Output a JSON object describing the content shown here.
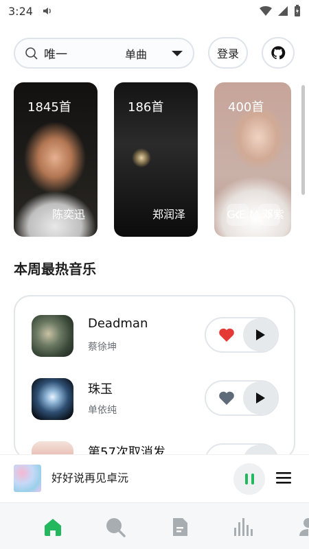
{
  "status_bar": {
    "time": "3:24"
  },
  "search": {
    "query": "唯一",
    "type": "单曲"
  },
  "header": {
    "login_label": "登录"
  },
  "artists": [
    {
      "count": "1845首",
      "name": "陈奕迅"
    },
    {
      "count": "186首",
      "name": "郑润泽"
    },
    {
      "count": "400首",
      "name": "G.E.M.邓紫"
    }
  ],
  "section": {
    "title": "本周最热音乐"
  },
  "tracks": [
    {
      "title": "Deadman",
      "artist": "蔡徐坤",
      "liked": true
    },
    {
      "title": "珠玉",
      "artist": "单依纯",
      "liked": false
    },
    {
      "title": "第57次取消发",
      "artist": "",
      "liked": false
    }
  ],
  "mini_player": {
    "title": "好好说再见卓沅"
  },
  "colors": {
    "accent": "#23b85d",
    "like": "#e53935",
    "muted": "#5f6b78"
  },
  "icons": {
    "nav": [
      "home-icon",
      "search-icon",
      "document-icon",
      "chart-icon",
      "user-icon"
    ]
  }
}
